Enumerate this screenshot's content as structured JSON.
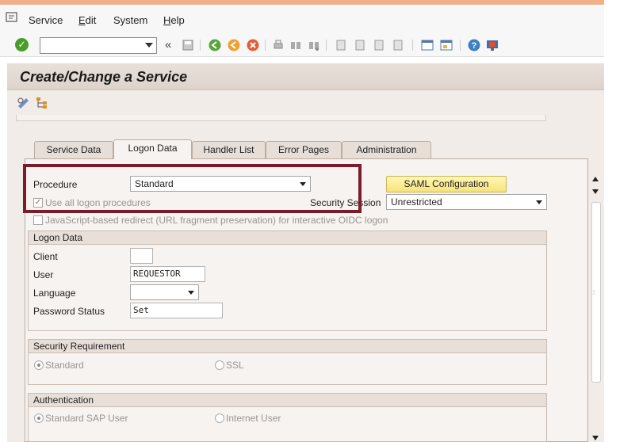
{
  "menu": {
    "items": [
      "Service",
      "Edit",
      "System",
      "Help"
    ],
    "underline": [
      "",
      "E",
      "",
      "H"
    ]
  },
  "toolbar": {
    "command_value": "",
    "chevron": "«"
  },
  "title": "Create/Change a Service",
  "tabs": [
    {
      "label": "Service Data",
      "active": false
    },
    {
      "label": "Logon Data",
      "active": true
    },
    {
      "label": "Handler List",
      "active": false
    },
    {
      "label": "Error Pages",
      "active": false
    },
    {
      "label": "Administration",
      "active": false
    }
  ],
  "form": {
    "procedure_label": "Procedure",
    "procedure_value": "Standard",
    "saml_button": "SAML Configuration",
    "use_all_label": "Use all logon procedures",
    "security_session_label": "Security Session",
    "security_session_value": "Unrestricted",
    "js_redirect_label": "JavaScript-based redirect (URL fragment preservation) for interactive OIDC logon"
  },
  "logon_data": {
    "title": "Logon Data",
    "client_label": "Client",
    "client_value": "",
    "user_label": "User",
    "user_value": "REQUESTOR",
    "language_label": "Language",
    "language_value": "",
    "password_status_label": "Password Status",
    "password_status_value": "Set"
  },
  "security_requirement": {
    "title": "Security Requirement",
    "option1": "Standard",
    "option2": "SSL",
    "selected": "Standard"
  },
  "authentication": {
    "title": "Authentication",
    "option1": "Standard SAP User",
    "option2": "Internet User",
    "selected": "Standard SAP User"
  },
  "colors": {
    "highlight_border": "#7a1d2a",
    "button_yellow": "#f7e37a",
    "panel_bg": "#f7f3f0"
  }
}
